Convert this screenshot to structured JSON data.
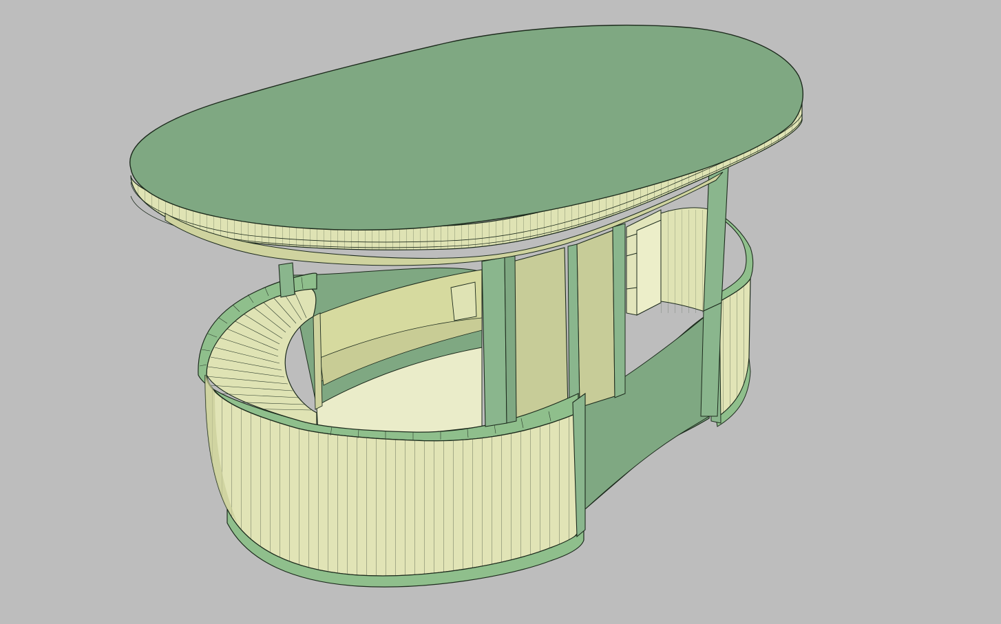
{
  "viewport": {
    "background": "#bdbdbd",
    "render_mode": "shaded-with-edges"
  },
  "model": {
    "colors": {
      "edge": "#1c2a1c",
      "green": "#7fa882",
      "green_light": "#8ab68d",
      "green_band": "#8fbf8c",
      "cream": "#dfe3b4",
      "cream_light": "#e9ecc4",
      "cream_dark": "#cfd39f",
      "shadow": "#b9bf8c",
      "floor": "#7fa882"
    },
    "parts": [
      "roof-canopy",
      "roof-fascia",
      "support-columns",
      "curved-counter-wall",
      "counter-top",
      "back-wall",
      "shelving",
      "floor-slab",
      "right-curved-wall"
    ]
  }
}
